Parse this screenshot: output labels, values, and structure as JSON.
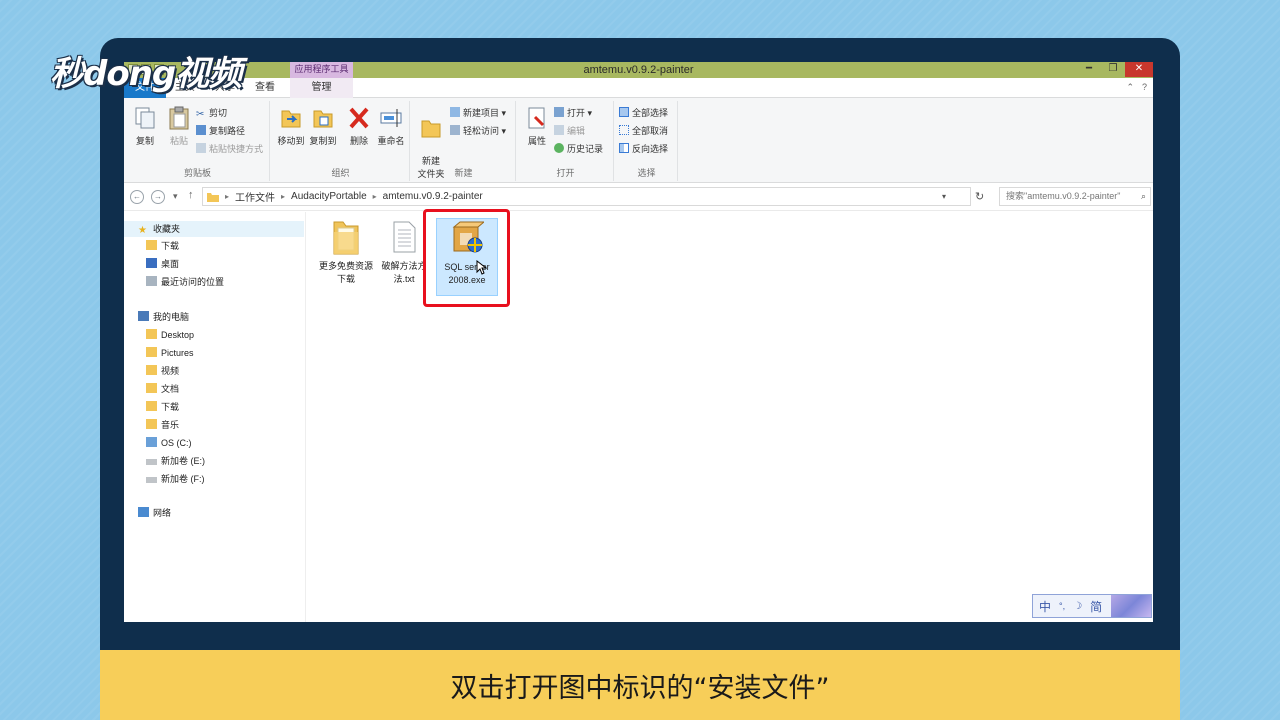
{
  "logo": {
    "text": "秒dong视频"
  },
  "window": {
    "title": "amtemu.v0.9.2-painter",
    "context_tab_label": "应用程序工具",
    "controls": {
      "minimize": "━",
      "restore": "❐",
      "close": "✕"
    }
  },
  "tabs": [
    {
      "label": "文件"
    },
    {
      "label": "主页"
    },
    {
      "label": "共享"
    },
    {
      "label": "查看"
    },
    {
      "label": "管理"
    }
  ],
  "ribbon": {
    "clipboard": {
      "label": "剪贴板",
      "copy": "复制",
      "paste": "粘贴",
      "cut": "剪切",
      "copy_path": "复制路径",
      "paste_shortcut": "粘贴快捷方式"
    },
    "organize": {
      "label": "组织",
      "move_to": "移动到",
      "copy_to": "复制到",
      "delete": "删除",
      "rename": "重命名"
    },
    "new": {
      "label": "新建",
      "new_folder": "新建\n文件夹",
      "new_item": "新建项目",
      "easy_access": "轻松访问"
    },
    "open": {
      "label": "打开",
      "properties": "属性",
      "open": "打开",
      "edit": "编辑",
      "history": "历史记录"
    },
    "select": {
      "label": "选择",
      "select_all": "全部选择",
      "select_none": "全部取消",
      "invert": "反向选择"
    }
  },
  "address": {
    "path": [
      "工作文件",
      "AudacityPortable",
      "amtemu.v0.9.2-painter"
    ],
    "search_placeholder": "搜索\"amtemu.v0.9.2-painter\""
  },
  "navpane": {
    "favorites": "收藏夹",
    "favorites_items": [
      "下载",
      "桌面",
      "最近访问的位置"
    ],
    "this_pc": "我的电脑",
    "pc_items": [
      "Desktop",
      "Pictures",
      "视频",
      "文档",
      "下载",
      "音乐",
      "OS (C:)",
      "新加卷 (E:)",
      "新加卷 (F:)"
    ],
    "network": "网络"
  },
  "files": [
    {
      "name": "更多免费资源下载",
      "type": "folder-icon"
    },
    {
      "name": "破解方法方法.txt",
      "type": "text-file-icon"
    },
    {
      "name": "SQL server 2008.exe",
      "type": "installer-icon"
    }
  ],
  "ime": {
    "mode": "中",
    "punct": "°,",
    "moon": "☽",
    "variant": "简"
  },
  "caption": "双击打开图中标识的“安装文件”",
  "colors": {
    "titlebar": "#a8b860",
    "file_tab": "#1979ca",
    "highlight": "#e8101e",
    "caption_bar": "#f7ce59",
    "frame": "#0f2e4c"
  }
}
